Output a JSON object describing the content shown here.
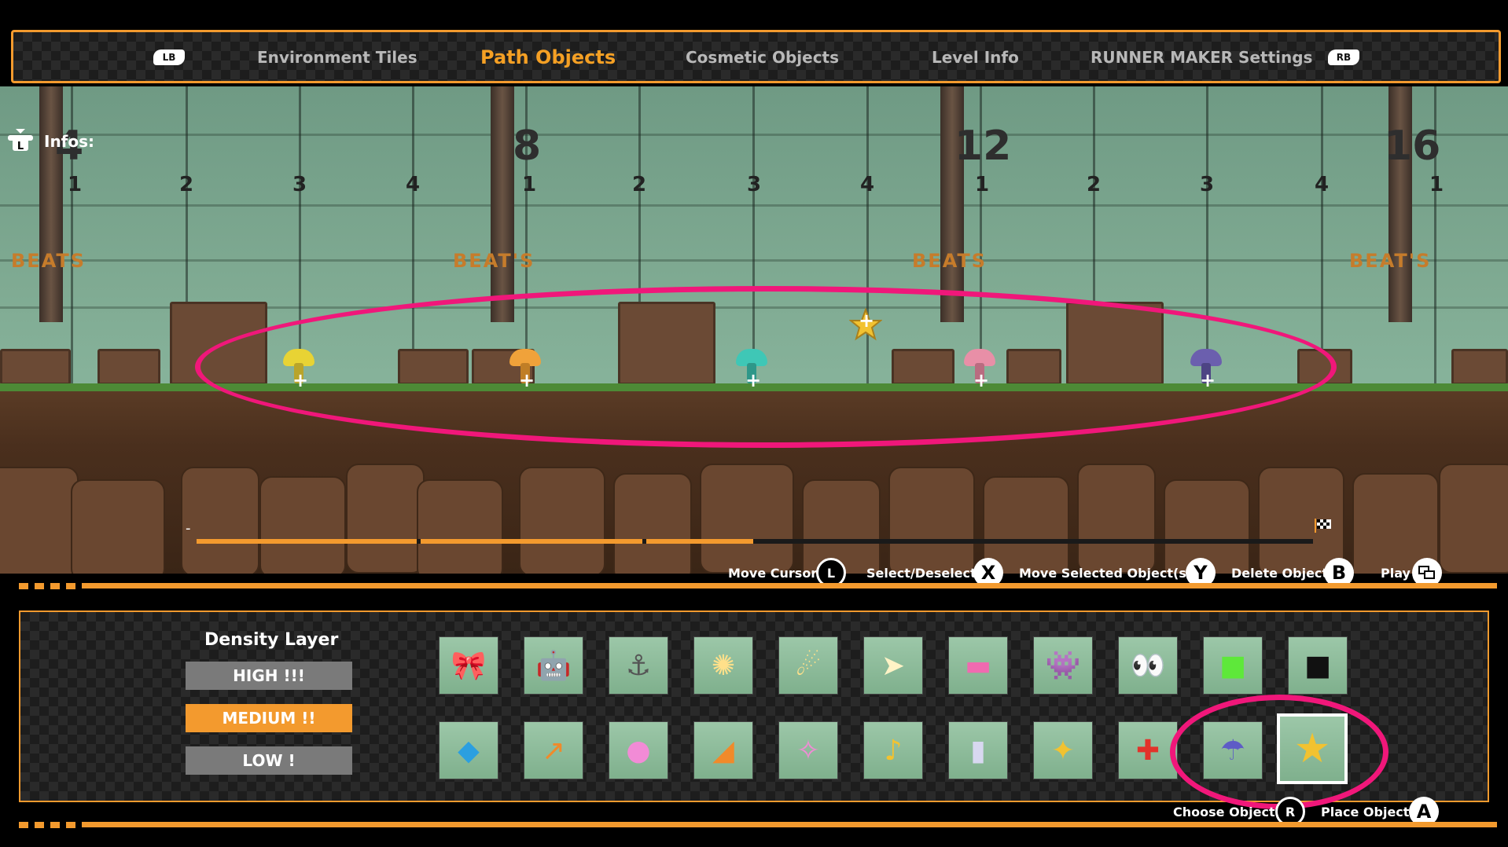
{
  "tabs": {
    "lb": "LB",
    "rb": "RB",
    "items": [
      {
        "label": "Environment Tiles",
        "active": false
      },
      {
        "label": "Path Objects",
        "active": true
      },
      {
        "label": "Cosmetic Objects",
        "active": false
      },
      {
        "label": "Level Info",
        "active": false
      },
      {
        "label": "RUNNER MAKER Settings",
        "active": false
      }
    ]
  },
  "infos": {
    "label": "Infos:",
    "icon": "L-stick-icon",
    "stick": "L"
  },
  "bars": [
    {
      "bar": "4",
      "beats": [
        "1",
        "2",
        "3",
        "4"
      ]
    },
    {
      "bar": "8",
      "beats": [
        "1",
        "2",
        "3",
        "4"
      ]
    },
    {
      "bar": "12",
      "beats": [
        "1",
        "2",
        "3",
        "4"
      ]
    },
    {
      "bar": "16",
      "beats": [
        "1"
      ]
    }
  ],
  "signs": [
    "BEATS",
    "BEAT'S",
    "BEATS",
    "BEAT'S"
  ],
  "path_objects": [
    {
      "type": "bounce-pad",
      "color": "#e8d334"
    },
    {
      "type": "bounce-pad",
      "color": "#f0a23a"
    },
    {
      "type": "bounce-pad",
      "color": "#3fc7b6"
    },
    {
      "type": "bounce-pad",
      "color": "#e88fa7"
    },
    {
      "type": "bounce-pad",
      "color": "#6b5fae"
    },
    {
      "type": "gold-star",
      "color": "#f2c230"
    }
  ],
  "plus_marker": "+",
  "cursor_marker": "-",
  "controls": {
    "move_cursor": {
      "label": "Move Cursor",
      "button": "L"
    },
    "select": {
      "label": "Select/Deselect",
      "button": "X"
    },
    "move_selected": {
      "label": "Move Selected Object(s)",
      "button": "Y"
    },
    "delete": {
      "label": "Delete Object",
      "button": "B"
    },
    "play": {
      "label": "Play",
      "button": "view-icon"
    },
    "choose": {
      "label": "Choose Object",
      "button": "R"
    },
    "place": {
      "label": "Place Object",
      "button": "A"
    }
  },
  "density": {
    "title": "Density Layer",
    "options": [
      {
        "label": "HIGH !!!",
        "active": false
      },
      {
        "label": "MEDIUM !!",
        "active": true
      },
      {
        "label": "LOW !",
        "active": false
      }
    ]
  },
  "palette_rows": [
    [
      {
        "icon": "pink-bow-icon",
        "glyph": "🎀"
      },
      {
        "icon": "red-robot-ladder-icon",
        "glyph": "🤖"
      },
      {
        "icon": "hanging-weight-icon",
        "glyph": "⚓"
      },
      {
        "icon": "fireball-icon",
        "glyph": "✺"
      },
      {
        "icon": "fast-fireball-icon",
        "glyph": "☄"
      },
      {
        "icon": "laser-beam-icon",
        "glyph": "➤"
      },
      {
        "icon": "pink-platform-icon",
        "glyph": "▬"
      },
      {
        "icon": "robot-blue-icon",
        "glyph": "👾"
      },
      {
        "icon": "robot-eyes-icon",
        "glyph": "👀"
      },
      {
        "icon": "green-block-icon",
        "glyph": "■"
      },
      {
        "icon": "black-block-icon",
        "glyph": "■"
      }
    ],
    [
      {
        "icon": "blue-diamond-icon",
        "glyph": "◆"
      },
      {
        "icon": "orange-arc-icon",
        "glyph": "↗"
      },
      {
        "icon": "pink-orb-arc-icon",
        "glyph": "●"
      },
      {
        "icon": "orange-ramp-icon",
        "glyph": "◢"
      },
      {
        "icon": "pink-swirl-icon",
        "glyph": "✧"
      },
      {
        "icon": "music-note-icon",
        "glyph": "♪"
      },
      {
        "icon": "light-pillar-icon",
        "glyph": "▮"
      },
      {
        "icon": "gold-sparkle-icon",
        "glyph": "✦"
      },
      {
        "icon": "red-cross-icon",
        "glyph": "✚"
      },
      {
        "icon": "rainbow-pad-icon",
        "glyph": "☂"
      },
      {
        "icon": "gold-star-icon",
        "glyph": "★",
        "selected": true
      }
    ]
  ],
  "colors": {
    "accent": "#f39a2e",
    "highlight": "#f0177a",
    "tab_inactive": "#b8b8b8"
  }
}
